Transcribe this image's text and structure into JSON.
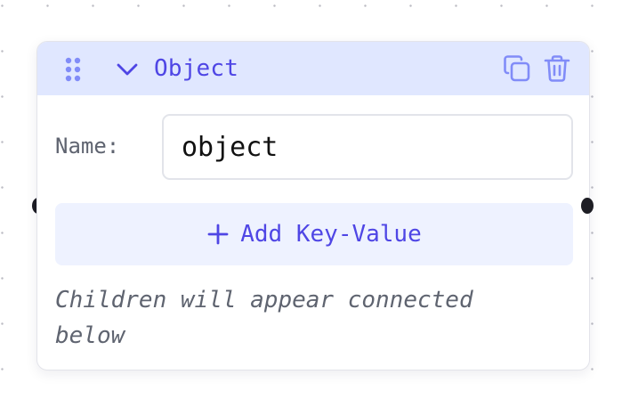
{
  "node": {
    "title": "Object",
    "name_label": "Name:",
    "name_value": "object",
    "add_button_label": "Add Key-Value",
    "hint": "Children will appear connected below"
  },
  "icons": {
    "drag": "drag-handle-icon",
    "collapse": "chevron-down-icon",
    "duplicate": "copy-icon",
    "delete": "trash-icon",
    "add": "plus-icon"
  },
  "colors": {
    "accent": "#4f46e5",
    "icon": "#818cf8",
    "header_bg": "#e0e7ff",
    "button_bg": "#eef2ff",
    "handle": "#1d1d24"
  }
}
